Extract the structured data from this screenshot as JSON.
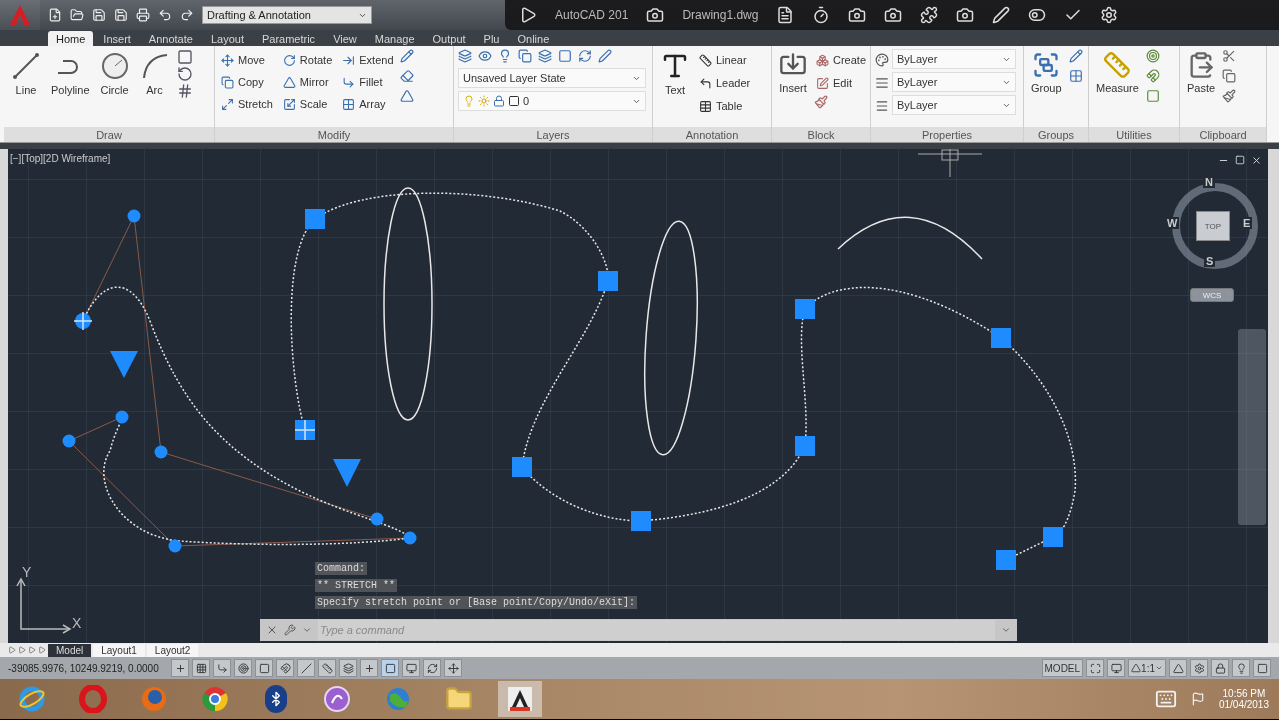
{
  "quick_access": {
    "workspace": "Drafting & Annotation"
  },
  "title_parts": [
    "AutoCAD 201",
    "Drawing1.dwg"
  ],
  "tabs": [
    {
      "label": "Home",
      "selected": true
    },
    {
      "label": "Insert",
      "selected": false
    },
    {
      "label": "Annotate",
      "selected": false
    },
    {
      "label": "Layout",
      "selected": false
    },
    {
      "label": "Parametric",
      "selected": false
    },
    {
      "label": "View",
      "selected": false
    },
    {
      "label": "Manage",
      "selected": false
    },
    {
      "label": "Output",
      "selected": false
    },
    {
      "label": "Plu",
      "selected": false
    },
    {
      "label": "Online",
      "selected": false
    }
  ],
  "ribbon": [
    {
      "kind": "draw",
      "title": "Draw",
      "tools": [
        "Line",
        "Polyline",
        "Circle",
        "Arc"
      ]
    },
    {
      "kind": "modify",
      "title": "Modify",
      "tools": [
        "Move",
        "Rotate",
        "Extend",
        "Copy",
        "Mirror",
        "Fillet",
        "Stretch",
        "Scale",
        "Array"
      ]
    },
    {
      "kind": "layers",
      "title": "Layers",
      "state": "Unsaved Layer State",
      "layer": "0"
    },
    {
      "kind": "annotation",
      "title": "Annotation",
      "main": "Text",
      "tools": [
        "Linear",
        "Leader",
        "Table"
      ]
    },
    {
      "kind": "block",
      "title": "Block",
      "main": "Insert",
      "tools": [
        "Create",
        "Edit"
      ]
    },
    {
      "kind": "properties",
      "title": "Properties",
      "values": [
        "ByLayer",
        "ByLayer",
        "ByLayer"
      ]
    },
    {
      "kind": "groups",
      "title": "Groups",
      "main": "Group"
    },
    {
      "kind": "utilities",
      "title": "Utilities",
      "main": "Measure"
    },
    {
      "kind": "clipboard",
      "title": "Clipboard",
      "main": "Paste"
    }
  ],
  "viewport": {
    "label": "[−][Top][2D Wireframe]",
    "viewcube": {
      "top": "TOP",
      "north": "N",
      "south": "S",
      "east": "E",
      "west": "W"
    },
    "ucs_menu": "WCS",
    "axes": {
      "x": "X",
      "y": "Y"
    }
  },
  "command": {
    "history": [
      "Command:",
      "** STRETCH **",
      "Specify stretch point or [Base point/Copy/Undo/eXit]:"
    ],
    "placeholder": "Type a command"
  },
  "layout_tabs": [
    {
      "label": "Model",
      "selected": true
    },
    {
      "label": "Layout1",
      "selected": false
    },
    {
      "label": "Layout2",
      "selected": false
    }
  ],
  "status_bar": {
    "coordinates": "-39085.9976, 10249.9219, 0.0000",
    "space": "MODEL",
    "scale": "1:1"
  },
  "taskbar": {
    "apps": [
      {
        "kind": "ie",
        "selected": false
      },
      {
        "kind": "opera",
        "selected": false
      },
      {
        "kind": "firefox",
        "selected": false
      },
      {
        "kind": "chrome",
        "selected": false
      },
      {
        "kind": "bluetooth",
        "selected": false
      },
      {
        "kind": "purple",
        "selected": false
      },
      {
        "kind": "globe",
        "selected": false
      },
      {
        "kind": "folder",
        "selected": false
      },
      {
        "kind": "autocad",
        "selected": true
      }
    ],
    "time": "10:56 PM",
    "date": "01/04/2013"
  }
}
